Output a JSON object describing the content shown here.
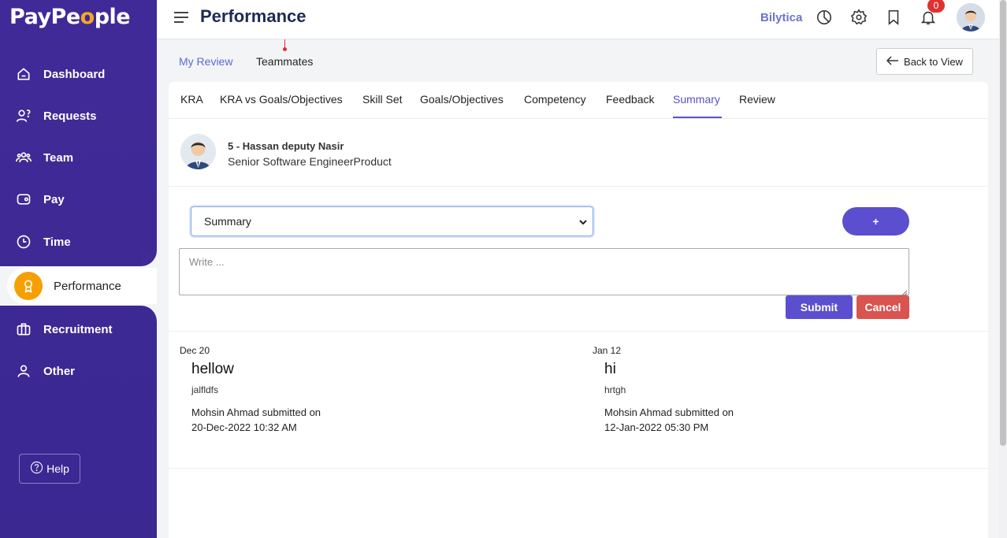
{
  "brand": {
    "logo_prefix": "PayPe",
    "logo_accent": "o",
    "logo_suffix": "ple"
  },
  "sidebar": {
    "items": [
      {
        "label": "Dashboard",
        "icon": "home-icon"
      },
      {
        "label": "Requests",
        "icon": "person-question-icon"
      },
      {
        "label": "Team",
        "icon": "team-icon"
      },
      {
        "label": "Pay",
        "icon": "wallet-icon"
      },
      {
        "label": "Time",
        "icon": "clock-icon"
      },
      {
        "label": "Performance",
        "icon": "award-icon",
        "active": true
      },
      {
        "label": "Recruitment",
        "icon": "briefcase-icon"
      },
      {
        "label": "Other",
        "icon": "user-icon"
      }
    ],
    "help_label": "Help"
  },
  "header": {
    "title": "Performance",
    "bilytica": "Bilytica",
    "notification_count": "0"
  },
  "top_tabs": {
    "my_review": "My Review",
    "teammates": "Teammates",
    "back_label": "Back to View"
  },
  "sub_tabs": [
    "KRA",
    "KRA vs Goals/Objectives",
    "Skill Set",
    "Goals/Objectives",
    "Competency",
    "Feedback",
    "Summary",
    "Review"
  ],
  "active_sub_tab": "Summary",
  "person": {
    "name": "5 - Hassan deputy Nasir",
    "role": "Senior Software EngineerProduct"
  },
  "form": {
    "select_value": "Summary",
    "plus_label": "+",
    "textarea_placeholder": "Write ...",
    "submit_label": "Submit",
    "cancel_label": "Cancel"
  },
  "entries": [
    {
      "date": "Dec 20",
      "title": "hellow",
      "desc": "jalfldfs",
      "by": "Mohsin Ahmad submitted on",
      "when": "20-Dec-2022 10:32 AM"
    },
    {
      "date": "Jan 12",
      "title": "hi",
      "desc": "hrtgh",
      "by": "Mohsin Ahmad submitted on",
      "when": "12-Jan-2022 05:30 PM"
    }
  ],
  "colors": {
    "sidebar": "#3f2a96",
    "accent": "#5b4fcf",
    "active_icon": "#f5a000",
    "danger": "#d9534f"
  }
}
